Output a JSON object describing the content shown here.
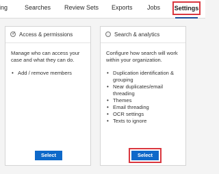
{
  "tabs": [
    {
      "label": "ing"
    },
    {
      "label": "Searches"
    },
    {
      "label": "Review Sets"
    },
    {
      "label": "Exports"
    },
    {
      "label": "Jobs"
    },
    {
      "label": "Settings"
    }
  ],
  "cards": [
    {
      "title": "Access & permissions",
      "icon": "check-circle-icon",
      "description": "Manage who can access your case and what they can do.",
      "items": [
        "Add / remove members"
      ],
      "button_label": "Select"
    },
    {
      "title": "Search & analytics",
      "icon": "circle-icon",
      "description": "Configure how search will work within your organization.",
      "items": [
        "Duplication identification & grouping",
        "Near duplicates/email threading",
        "Themes",
        "Email threading",
        "OCR settings",
        "Texts to ignore"
      ],
      "button_label": "Select"
    }
  ],
  "colors": {
    "accent": "#0e69c9",
    "highlight": "#d9363e"
  }
}
